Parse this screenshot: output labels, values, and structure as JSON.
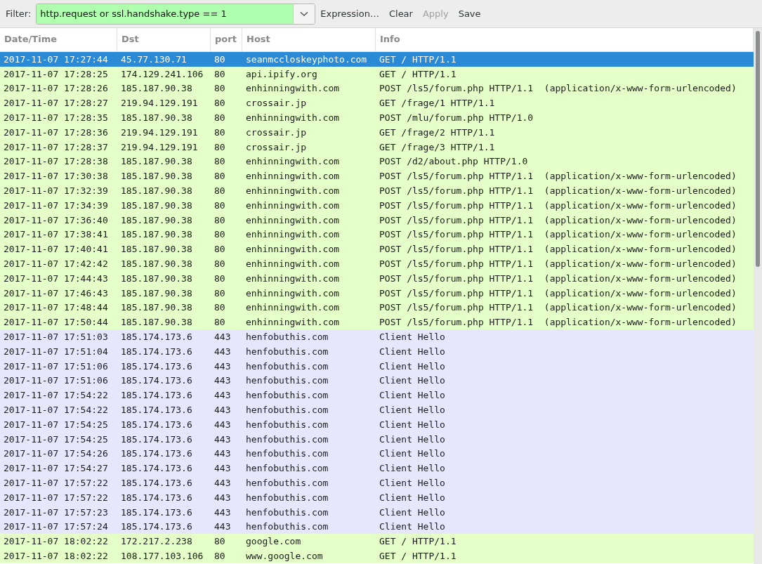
{
  "filter": {
    "label": "Filter:",
    "value": "http.request or ssl.handshake.type == 1",
    "buttons": [
      {
        "label": "Expression…",
        "disabled": false
      },
      {
        "label": "Clear",
        "disabled": false
      },
      {
        "label": "Apply",
        "disabled": true
      },
      {
        "label": "Save",
        "disabled": false
      }
    ]
  },
  "table": {
    "columns": [
      "Date/Time",
      "Dst",
      "port",
      "Host",
      "Info"
    ],
    "rows": [
      {
        "selected": true,
        "cells": [
          "2017-11-07 17:27:44",
          "45.77.130.71",
          "80",
          "seanmccloskeyphoto.com",
          "GET / HTTP/1.1"
        ]
      },
      {
        "kind": "http",
        "selected": false,
        "cells": [
          "2017-11-07 17:28:25",
          "174.129.241.106",
          "80",
          "api.ipify.org",
          "GET / HTTP/1.1"
        ]
      },
      {
        "kind": "http",
        "selected": false,
        "cells": [
          "2017-11-07 17:28:26",
          "185.187.90.38",
          "80",
          "enhinningwith.com",
          "POST /ls5/forum.php HTTP/1.1  (application/x-www-form-urlencoded)"
        ]
      },
      {
        "kind": "http",
        "selected": false,
        "cells": [
          "2017-11-07 17:28:27",
          "219.94.129.191",
          "80",
          "crossair.jp",
          "GET /frage/1 HTTP/1.1"
        ]
      },
      {
        "kind": "http",
        "selected": false,
        "cells": [
          "2017-11-07 17:28:35",
          "185.187.90.38",
          "80",
          "enhinningwith.com",
          "POST /mlu/forum.php HTTP/1.0"
        ]
      },
      {
        "kind": "http",
        "selected": false,
        "cells": [
          "2017-11-07 17:28:36",
          "219.94.129.191",
          "80",
          "crossair.jp",
          "GET /frage/2 HTTP/1.1"
        ]
      },
      {
        "kind": "http",
        "selected": false,
        "cells": [
          "2017-11-07 17:28:37",
          "219.94.129.191",
          "80",
          "crossair.jp",
          "GET /frage/3 HTTP/1.1"
        ]
      },
      {
        "kind": "http",
        "selected": false,
        "cells": [
          "2017-11-07 17:28:38",
          "185.187.90.38",
          "80",
          "enhinningwith.com",
          "POST /d2/about.php HTTP/1.0"
        ]
      },
      {
        "kind": "http",
        "selected": false,
        "cells": [
          "2017-11-07 17:30:38",
          "185.187.90.38",
          "80",
          "enhinningwith.com",
          "POST /ls5/forum.php HTTP/1.1  (application/x-www-form-urlencoded)"
        ]
      },
      {
        "kind": "http",
        "selected": false,
        "cells": [
          "2017-11-07 17:32:39",
          "185.187.90.38",
          "80",
          "enhinningwith.com",
          "POST /ls5/forum.php HTTP/1.1  (application/x-www-form-urlencoded)"
        ]
      },
      {
        "kind": "http",
        "selected": false,
        "cells": [
          "2017-11-07 17:34:39",
          "185.187.90.38",
          "80",
          "enhinningwith.com",
          "POST /ls5/forum.php HTTP/1.1  (application/x-www-form-urlencoded)"
        ]
      },
      {
        "kind": "http",
        "selected": false,
        "cells": [
          "2017-11-07 17:36:40",
          "185.187.90.38",
          "80",
          "enhinningwith.com",
          "POST /ls5/forum.php HTTP/1.1  (application/x-www-form-urlencoded)"
        ]
      },
      {
        "kind": "http",
        "selected": false,
        "cells": [
          "2017-11-07 17:38:41",
          "185.187.90.38",
          "80",
          "enhinningwith.com",
          "POST /ls5/forum.php HTTP/1.1  (application/x-www-form-urlencoded)"
        ]
      },
      {
        "kind": "http",
        "selected": false,
        "cells": [
          "2017-11-07 17:40:41",
          "185.187.90.38",
          "80",
          "enhinningwith.com",
          "POST /ls5/forum.php HTTP/1.1  (application/x-www-form-urlencoded)"
        ]
      },
      {
        "kind": "http",
        "selected": false,
        "cells": [
          "2017-11-07 17:42:42",
          "185.187.90.38",
          "80",
          "enhinningwith.com",
          "POST /ls5/forum.php HTTP/1.1  (application/x-www-form-urlencoded)"
        ]
      },
      {
        "kind": "http",
        "selected": false,
        "cells": [
          "2017-11-07 17:44:43",
          "185.187.90.38",
          "80",
          "enhinningwith.com",
          "POST /ls5/forum.php HTTP/1.1  (application/x-www-form-urlencoded)"
        ]
      },
      {
        "kind": "http",
        "selected": false,
        "cells": [
          "2017-11-07 17:46:43",
          "185.187.90.38",
          "80",
          "enhinningwith.com",
          "POST /ls5/forum.php HTTP/1.1  (application/x-www-form-urlencoded)"
        ]
      },
      {
        "kind": "http",
        "selected": false,
        "cells": [
          "2017-11-07 17:48:44",
          "185.187.90.38",
          "80",
          "enhinningwith.com",
          "POST /ls5/forum.php HTTP/1.1  (application/x-www-form-urlencoded)"
        ]
      },
      {
        "kind": "http",
        "selected": false,
        "cells": [
          "2017-11-07 17:50:44",
          "185.187.90.38",
          "80",
          "enhinningwith.com",
          "POST /ls5/forum.php HTTP/1.1  (application/x-www-form-urlencoded)"
        ]
      },
      {
        "kind": "tls",
        "selected": false,
        "cells": [
          "2017-11-07 17:51:03",
          "185.174.173.6",
          "443",
          "henfobuthis.com",
          "Client Hello"
        ]
      },
      {
        "kind": "tls",
        "selected": false,
        "cells": [
          "2017-11-07 17:51:04",
          "185.174.173.6",
          "443",
          "henfobuthis.com",
          "Client Hello"
        ]
      },
      {
        "kind": "tls",
        "selected": false,
        "cells": [
          "2017-11-07 17:51:06",
          "185.174.173.6",
          "443",
          "henfobuthis.com",
          "Client Hello"
        ]
      },
      {
        "kind": "tls",
        "selected": false,
        "cells": [
          "2017-11-07 17:51:06",
          "185.174.173.6",
          "443",
          "henfobuthis.com",
          "Client Hello"
        ]
      },
      {
        "kind": "tls",
        "selected": false,
        "cells": [
          "2017-11-07 17:54:22",
          "185.174.173.6",
          "443",
          "henfobuthis.com",
          "Client Hello"
        ]
      },
      {
        "kind": "tls",
        "selected": false,
        "cells": [
          "2017-11-07 17:54:22",
          "185.174.173.6",
          "443",
          "henfobuthis.com",
          "Client Hello"
        ]
      },
      {
        "kind": "tls",
        "selected": false,
        "cells": [
          "2017-11-07 17:54:25",
          "185.174.173.6",
          "443",
          "henfobuthis.com",
          "Client Hello"
        ]
      },
      {
        "kind": "tls",
        "selected": false,
        "cells": [
          "2017-11-07 17:54:25",
          "185.174.173.6",
          "443",
          "henfobuthis.com",
          "Client Hello"
        ]
      },
      {
        "kind": "tls",
        "selected": false,
        "cells": [
          "2017-11-07 17:54:26",
          "185.174.173.6",
          "443",
          "henfobuthis.com",
          "Client Hello"
        ]
      },
      {
        "kind": "tls",
        "selected": false,
        "cells": [
          "2017-11-07 17:54:27",
          "185.174.173.6",
          "443",
          "henfobuthis.com",
          "Client Hello"
        ]
      },
      {
        "kind": "tls",
        "selected": false,
        "cells": [
          "2017-11-07 17:57:22",
          "185.174.173.6",
          "443",
          "henfobuthis.com",
          "Client Hello"
        ]
      },
      {
        "kind": "tls",
        "selected": false,
        "cells": [
          "2017-11-07 17:57:22",
          "185.174.173.6",
          "443",
          "henfobuthis.com",
          "Client Hello"
        ]
      },
      {
        "kind": "tls",
        "selected": false,
        "cells": [
          "2017-11-07 17:57:23",
          "185.174.173.6",
          "443",
          "henfobuthis.com",
          "Client Hello"
        ]
      },
      {
        "kind": "tls",
        "selected": false,
        "cells": [
          "2017-11-07 17:57:24",
          "185.174.173.6",
          "443",
          "henfobuthis.com",
          "Client Hello"
        ]
      },
      {
        "kind": "http",
        "selected": false,
        "cells": [
          "2017-11-07 18:02:22",
          "172.217.2.238",
          "80",
          "google.com",
          "GET / HTTP/1.1"
        ]
      },
      {
        "kind": "http",
        "selected": false,
        "cells": [
          "2017-11-07 18:02:22",
          "108.177.103.106",
          "80",
          "www.google.com",
          "GET / HTTP/1.1"
        ]
      }
    ]
  }
}
